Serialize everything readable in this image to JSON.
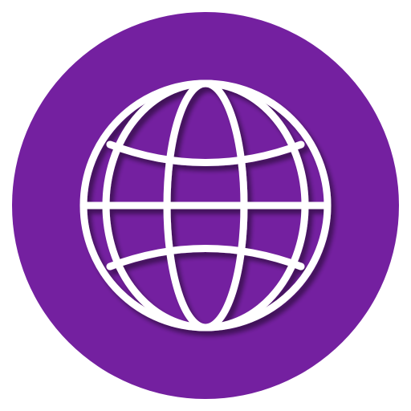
{
  "icon": {
    "name": "globe-icon",
    "background_color": "#7420a0",
    "stroke_color": "#ffffff",
    "shadow_color": "#3a0f52"
  }
}
